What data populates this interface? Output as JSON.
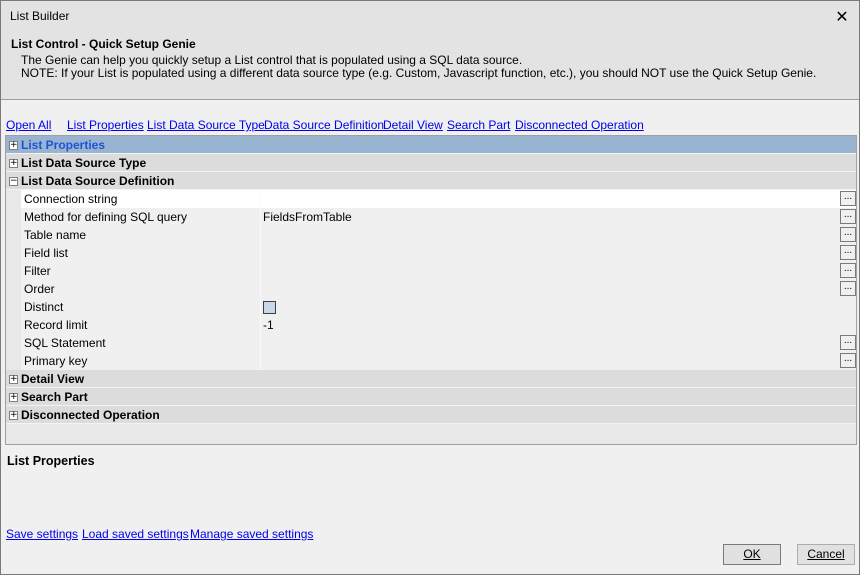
{
  "window": {
    "title": "List Builder"
  },
  "header": {
    "title": "List Control - Quick Setup Genie",
    "line1": "The Genie can help you quickly setup a List control that is populated using a SQL data source.",
    "line2": "NOTE: If your List is populated using a different data source type (e.g. Custom, Javascript function, etc.), you should NOT use the Quick Setup Genie."
  },
  "links": [
    "Open All",
    "List Properties",
    "List Data Source Type",
    "Data Source Definition",
    "Detail View",
    "Search Part",
    "Disconnected Operation"
  ],
  "grid": {
    "categories": {
      "list_properties": "List Properties",
      "list_data_source_type": "List Data Source Type",
      "list_data_source_definition": "List Data Source Definition",
      "detail_view": "Detail View",
      "search_part": "Search Part",
      "disconnected_operation": "Disconnected Operation"
    },
    "properties": [
      {
        "name": "Connection string",
        "value": ""
      },
      {
        "name": "Method for defining SQL query",
        "value": "FieldsFromTable"
      },
      {
        "name": "Table name",
        "value": ""
      },
      {
        "name": "Field list",
        "value": ""
      },
      {
        "name": "Filter",
        "value": ""
      },
      {
        "name": "Order",
        "value": ""
      },
      {
        "name": "Distinct",
        "value": "",
        "checked": false
      },
      {
        "name": "Record limit",
        "value": "-1"
      },
      {
        "name": "SQL Statement",
        "value": ""
      },
      {
        "name": "Primary key",
        "value": ""
      }
    ],
    "ellipsis_label": "..."
  },
  "description": {
    "title": "List Properties"
  },
  "bottom_links": [
    "Save settings",
    "Load saved settings",
    "Manage saved settings"
  ],
  "buttons": {
    "ok": "OK",
    "cancel": "Cancel"
  },
  "icons": {
    "close": "close-icon",
    "expand": "plus-icon",
    "collapse": "minus-icon"
  },
  "colors": {
    "selected_category": "#99b4d1",
    "link": "#0000ee"
  }
}
